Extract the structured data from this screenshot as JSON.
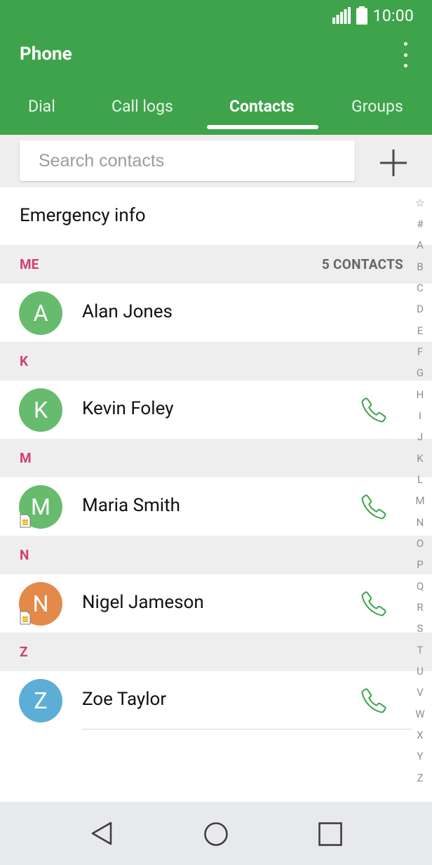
{
  "status": {
    "time": "10:00",
    "signal_icon": "signal-icon",
    "battery_icon": "battery-icon"
  },
  "appbar": {
    "title": "Phone",
    "menu_icon": "more-vert-icon"
  },
  "tabs": [
    {
      "label": "Dial",
      "active": false
    },
    {
      "label": "Call logs",
      "active": false
    },
    {
      "label": "Contacts",
      "active": true
    },
    {
      "label": "Groups",
      "active": false
    }
  ],
  "search": {
    "placeholder": "Search contacts",
    "value": "",
    "add_icon": "plus-icon"
  },
  "emergency": {
    "label": "Emergency info"
  },
  "sections": [
    {
      "letter": "ME",
      "count": "5 CONTACTS",
      "contacts": [
        {
          "initial": "A",
          "name": "Alan Jones",
          "color": "#67bb6d",
          "sim": false,
          "call": false
        }
      ]
    },
    {
      "letter": "K",
      "contacts": [
        {
          "initial": "K",
          "name": "Kevin Foley",
          "color": "#67bb6d",
          "sim": false,
          "call": true
        }
      ]
    },
    {
      "letter": "M",
      "contacts": [
        {
          "initial": "M",
          "name": "Maria Smith",
          "color": "#67bb6d",
          "sim": true,
          "call": true
        }
      ]
    },
    {
      "letter": "N",
      "contacts": [
        {
          "initial": "N",
          "name": "Nigel Jameson",
          "color": "#e3894a",
          "sim": true,
          "call": true
        }
      ]
    },
    {
      "letter": "Z",
      "contacts": [
        {
          "initial": "Z",
          "name": "Zoe Taylor",
          "color": "#5daed6",
          "sim": false,
          "call": true
        }
      ]
    }
  ],
  "index_letters": [
    "☆",
    "#",
    "A",
    "B",
    "C",
    "D",
    "E",
    "F",
    "G",
    "H",
    "I",
    "J",
    "K",
    "L",
    "M",
    "N",
    "O",
    "P",
    "Q",
    "R",
    "S",
    "T",
    "U",
    "V",
    "W",
    "X",
    "Y",
    "Z"
  ],
  "navbar": {
    "back_icon": "back-icon",
    "home_icon": "home-icon",
    "recents_icon": "recents-icon"
  },
  "colors": {
    "brand": "#3ea34b",
    "section_letter": "#d0416f",
    "call": "#3ea34b"
  }
}
